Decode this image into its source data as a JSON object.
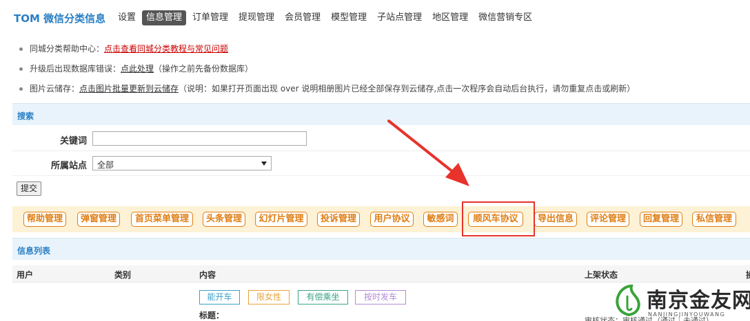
{
  "topnav": {
    "brand": "TOM 微信分类信息",
    "items": [
      {
        "label": "设置",
        "active": false
      },
      {
        "label": "信息管理",
        "active": true
      },
      {
        "label": "订单管理",
        "active": false
      },
      {
        "label": "提现管理",
        "active": false
      },
      {
        "label": "会员管理",
        "active": false
      },
      {
        "label": "模型管理",
        "active": false
      },
      {
        "label": "子站点管理",
        "active": false
      },
      {
        "label": "地区管理",
        "active": false
      },
      {
        "label": "微信营销专区",
        "active": false
      }
    ]
  },
  "help": {
    "line1_prefix": "同城分类帮助中心：",
    "line1_link": "点击查看同城分类教程与常见问题",
    "line2_prefix": "升级后出现数据库错误：",
    "line2_link": "点此处理",
    "line2_suffix": "（操作之前先备份数据库）",
    "line3_prefix": "图片云储存：",
    "line3_link": "点击图片批量更新到云储存",
    "line3_suffix": "（说明：如果打开页面出现 over 说明相册图片已经全部保存到云储存,点击一次程序会自动后台执行，请勿重复点击或刷新）"
  },
  "search": {
    "title": "搜索",
    "keyword_label": "关键词",
    "keyword_value": "",
    "site_label": "所属站点",
    "site_value": "全部",
    "submit_label": "提交"
  },
  "toolbar": {
    "buttons": [
      "帮助管理",
      "弹窗管理",
      "首页菜单管理",
      "头条管理",
      "幻灯片管理",
      "投诉管理",
      "用户协议",
      "敏感词",
      "顺风车协议",
      "导出信息",
      "评论管理",
      "回复管理",
      "私信管理"
    ]
  },
  "list": {
    "title": "信息列表",
    "columns": [
      "用户",
      "类别",
      "内容",
      "上架状态",
      "操"
    ],
    "tags": [
      {
        "label": "能开车",
        "color": "#3ba0c9"
      },
      {
        "label": "限女性",
        "color": "#e8a33b"
      },
      {
        "label": "有偿乘坐",
        "color": "#3aa387"
      },
      {
        "label": "按时发车",
        "color": "#b38ad6"
      }
    ],
    "row_title_label": "标题：",
    "row_status_partial": "审核状态：审核通过（通过｜未通过）"
  },
  "watermark": {
    "name": "南京金友网",
    "pinyin": "NANJINGJINYOUWANG"
  },
  "colors": {
    "brand": "#2a7fc4",
    "accent_orange": "#e07d12",
    "highlight_red": "#e8322b"
  }
}
